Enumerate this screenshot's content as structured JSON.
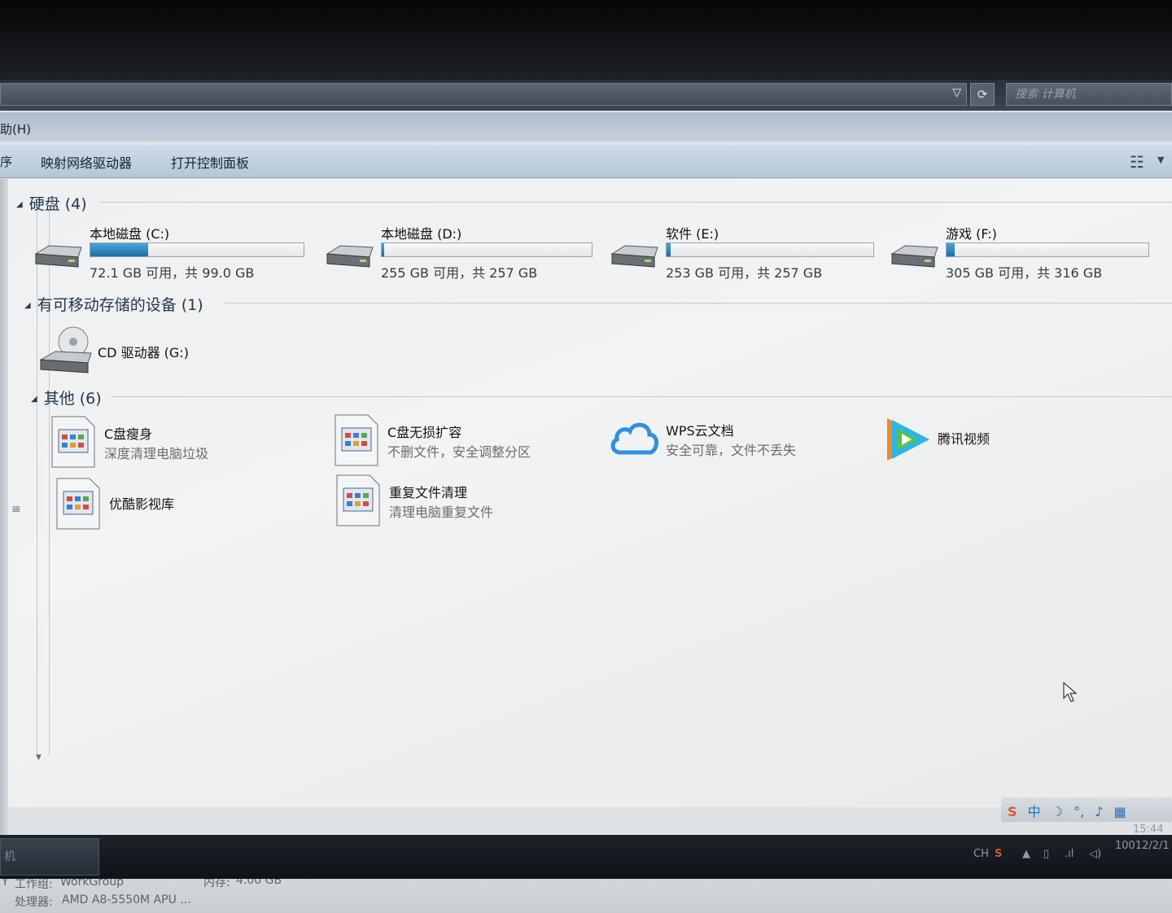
{
  "address_bar": {
    "search_placeholder": "搜索 计算机",
    "dropdown_icon": "chevron-down-icon",
    "refresh_icon": "refresh-icon"
  },
  "menu": {
    "help_label": "助(H)"
  },
  "toolbar": {
    "partial_item": "序",
    "map_drive": "映射网络驱动器",
    "control_panel": "打开控制面板",
    "view_icon": "view-options-icon"
  },
  "groups": {
    "hard_disks": {
      "header": "硬盘 (4)",
      "drives": [
        {
          "name": "本地磁盘 (C:)",
          "info": "72.1 GB 可用，共 99.0 GB",
          "used_fraction": 0.27
        },
        {
          "name": "本地磁盘 (D:)",
          "info": "255 GB 可用，共 257 GB",
          "used_fraction": 0.01
        },
        {
          "name": "软件 (E:)",
          "info": "253 GB 可用，共 257 GB",
          "used_fraction": 0.02
        },
        {
          "name": "游戏 (F:)",
          "info": "305 GB 可用，共 316 GB",
          "used_fraction": 0.04
        }
      ]
    },
    "removable": {
      "header": "有可移动存储的设备 (1)",
      "cd_name": "CD 驱动器 (G:)"
    },
    "other": {
      "header": "其他 (6)",
      "items": [
        {
          "title": "C盘瘦身",
          "subtitle": "深度清理电脑垃圾"
        },
        {
          "title": "C盘无损扩容",
          "subtitle": "不删文件，安全调整分区"
        },
        {
          "title": "WPS云文档",
          "subtitle": "安全可靠，文件不丢失"
        },
        {
          "title": "腾讯视频",
          "subtitle": ""
        },
        {
          "title": "优酷影视库",
          "subtitle": ""
        },
        {
          "title": "重复文件清理",
          "subtitle": "清理电脑重复文件"
        }
      ]
    }
  },
  "status": {
    "workgroup_label": "工作组:",
    "workgroup_value": "WorkGroup",
    "memory_label": "内存:",
    "memory_value": "4.00 GB",
    "cpu_label": "处理器:",
    "cpu_value": "AMD A8-5550M APU ...",
    "left_partial": "Y"
  },
  "ime_bar": {
    "text": "中"
  },
  "taskbar": {
    "start_partial": "机",
    "lang": "CH",
    "time": "15:44",
    "date": "10012/2/1"
  },
  "colors": {
    "bar_fill": "#1a6ea8",
    "wps_cloud": "#2f8fe0",
    "tencent_video": [
      "#f08a24",
      "#2bb5e8",
      "#5cc144"
    ]
  }
}
